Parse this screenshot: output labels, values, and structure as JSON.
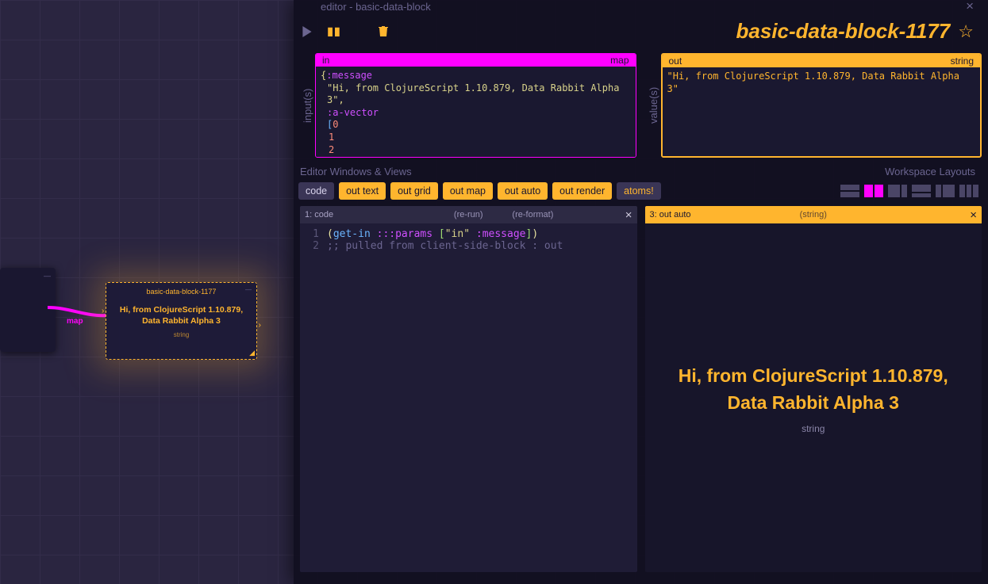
{
  "homepanel": {
    "header": "editor - basic-data-block",
    "title": "basic-data-block-1177"
  },
  "canvas": {
    "edge_label": "map",
    "selected_node": {
      "title": "basic-data-block-1177",
      "message": "Hi, from ClojureScript 1.10.879, Data Rabbit Alpha 3",
      "type": "string"
    }
  },
  "io": {
    "inputs_label": "input(s)",
    "values_label": "value(s)",
    "in": {
      "name": "in",
      "type": "map",
      "msg_key": ":message",
      "msg_val": "\"Hi, from ClojureScript 1.10.879, Data Rabbit Alpha 3\"",
      "vec_key": ":a-vector",
      "nums": [
        "0",
        "1",
        "2"
      ]
    },
    "out": {
      "name": "out",
      "type": "string",
      "value": "\"Hi, from ClojureScript 1.10.879, Data Rabbit Alpha 3\""
    }
  },
  "labels": {
    "views": "Editor Windows & Views",
    "layouts": "Workspace Layouts"
  },
  "view_buttons": [
    "code",
    "out text",
    "out grid",
    "out map",
    "out auto",
    "out render",
    "atoms!"
  ],
  "panes": {
    "code": {
      "title": "1: code",
      "rerun": "(re-run)",
      "reformat": "(re-format)",
      "line1_fn": "get-in",
      "line1_kw1": ":::params",
      "line1_str": "\"in\"",
      "line1_kw2": ":message",
      "line2": ";; pulled from client-side-block : out"
    },
    "auto": {
      "title": "3: out auto",
      "type_paren": "(string)",
      "message": "Hi, from ClojureScript 1.10.879, Data Rabbit Alpha 3",
      "type": "string"
    }
  }
}
